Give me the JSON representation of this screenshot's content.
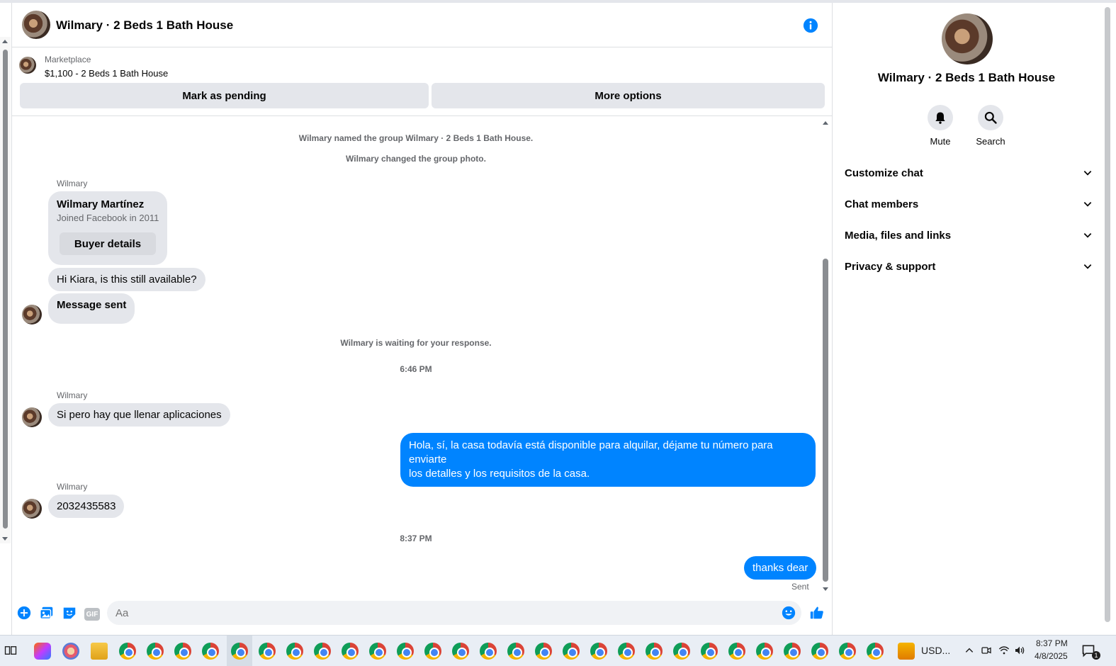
{
  "header": {
    "title": "Wilmary · 2 Beds 1 Bath House"
  },
  "marketplace": {
    "label": "Marketplace",
    "listing": "$1,100 - 2 Beds 1 Bath House",
    "mark_pending": "Mark as pending",
    "more_options": "More options"
  },
  "messages": {
    "sys_named": "Wilmary named the group Wilmary · 2 Beds 1 Bath House.",
    "sys_photo": "Wilmary changed the group photo.",
    "sender1": "Wilmary",
    "card_name": "Wilmary Martínez",
    "card_joined": "Joined Facebook in 2011",
    "card_button": "Buyer details",
    "msg1": "Hi Kiara, is this still available?",
    "msg2": "Message sent",
    "sys_waiting": "Wilmary is waiting for your response.",
    "time1": "6:46 PM",
    "sender2": "Wilmary",
    "msg3": "Si pero hay que llenar aplicaciones",
    "out1_line1": "Hola, sí, la casa todavía está disponible para alquilar, déjame tu número para enviarte",
    "out1_line2": "los detalles y los requisitos de la casa.",
    "sender3": "Wilmary",
    "msg4": "2032435583",
    "time2": "8:37 PM",
    "out2": "thanks dear",
    "status": "Sent"
  },
  "composer": {
    "placeholder": "Aa",
    "gif_label": "GIF"
  },
  "sidebar": {
    "name": "Wilmary · 2 Beds 1 Bath House",
    "mute": "Mute",
    "search": "Search",
    "rows": [
      "Customize chat",
      "Chat members",
      "Media, files and links",
      "Privacy & support"
    ]
  },
  "taskbar": {
    "currency": "USD...",
    "time": "8:37 PM",
    "date": "4/8/2025",
    "notif_count": "1"
  },
  "colors": {
    "accent": "#0084ff",
    "bubble_in": "#e4e6eb"
  }
}
